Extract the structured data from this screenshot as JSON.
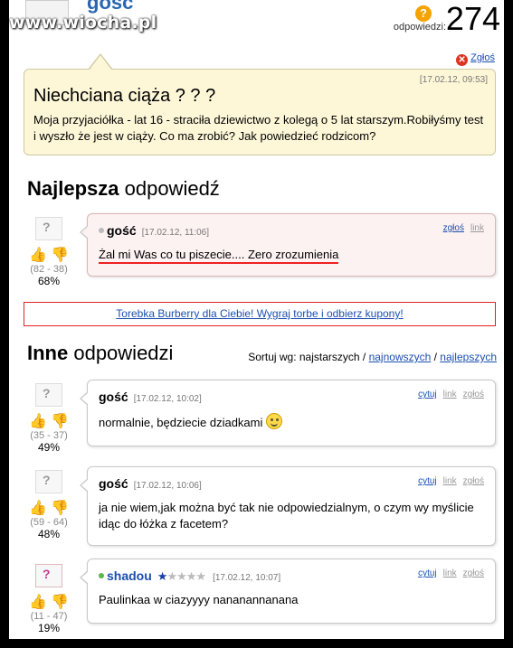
{
  "watermark": "www.wiocha.pl",
  "top": {
    "user": "gość",
    "answers_label": "odpowiedzi:",
    "answers_count": "274",
    "report_label": "Zgłoś"
  },
  "question": {
    "date": "[17.02.12, 09:53]",
    "title": "Niechciana ciąża ? ? ?",
    "body": "Moja przyjaciółka - lat 16 - straciła dziewictwo z kolegą o 5 lat starszym.Robiłyśmy test i wyszło że jest w ciąży. Co ma zrobić? Jak powiedzieć rodzicom?"
  },
  "best": {
    "heading_bold": "Najlepsza",
    "heading_rest": " odpowiedź",
    "user": "gość",
    "date": "[17.02.12, 11:06]",
    "links": [
      "zgłoś",
      "link"
    ],
    "text": "Żal mi Was co tu piszecie.... Zero zrozumienia",
    "counts": "(82 - 38)",
    "pct": "68%"
  },
  "banner": "Torebka Burberry dla Ciebie! Wygraj torbe i odbierz kupony!",
  "others": {
    "heading_bold": "Inne",
    "heading_rest": " odpowiedzi",
    "sort_label": "Sortuj wg: najstarszych / ",
    "sort_new": "najnowszych",
    "sort_sep": " / ",
    "sort_best": "najlepszych",
    "items": [
      {
        "user": "gość",
        "date": "[17.02.12, 10:02]",
        "text": "normalnie, będziecie dziadkami",
        "counts": "(35 - 37)",
        "pct": "49%",
        "links": [
          "cytuj",
          "link",
          "zgłoś"
        ]
      },
      {
        "user": "gość",
        "date": "[17.02.12, 10:06]",
        "text": "ja nie wiem,jak można być tak nie odpowiedzialnym, o czym wy myślicie idąc do łóżka z facetem?",
        "counts": "(59 - 64)",
        "pct": "48%",
        "links": [
          "cytuj",
          "link",
          "zgłoś"
        ]
      },
      {
        "user": "shadou",
        "date": "[17.02.12, 10:07]",
        "text": "Paulinkaa w ciazyyyy nananannanana",
        "counts": "(11 - 47)",
        "pct": "19%",
        "links": [
          "cytuj",
          "link",
          "zgłoś"
        ]
      }
    ]
  },
  "icons": {
    "thumb_up": "thumb-up-icon",
    "thumb_down": "thumb-down-icon",
    "avatar_placeholder": "?"
  }
}
